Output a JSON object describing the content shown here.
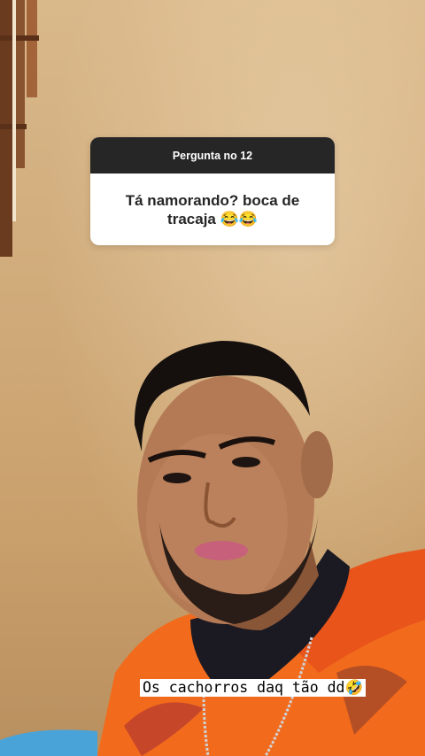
{
  "question_sticker": {
    "header": "Pergunta no 12",
    "question": "Tá namorando? boca de tracaja 😂😂"
  },
  "caption": {
    "text": "Os cachorros daq tão dd🤣"
  },
  "colors": {
    "sticker_header_bg": "#262626",
    "wall": "#cfa978",
    "shirt": "#f26b1d"
  }
}
